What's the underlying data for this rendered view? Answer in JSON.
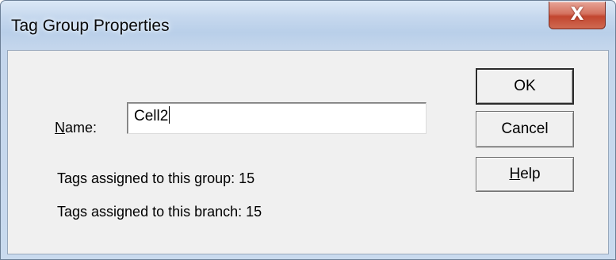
{
  "window": {
    "title": "Tag Group Properties"
  },
  "title_buttons": {
    "close_label": "X"
  },
  "form": {
    "name_label_accel": "N",
    "name_label_rest": "ame:",
    "name_value": "Cell2",
    "tags_group_text": "Tags assigned to this group:  15",
    "tags_branch_text": "Tags assigned to this branch:  15"
  },
  "buttons": {
    "ok": "OK",
    "cancel": "Cancel",
    "help_accel": "H",
    "help_rest": "elp"
  }
}
